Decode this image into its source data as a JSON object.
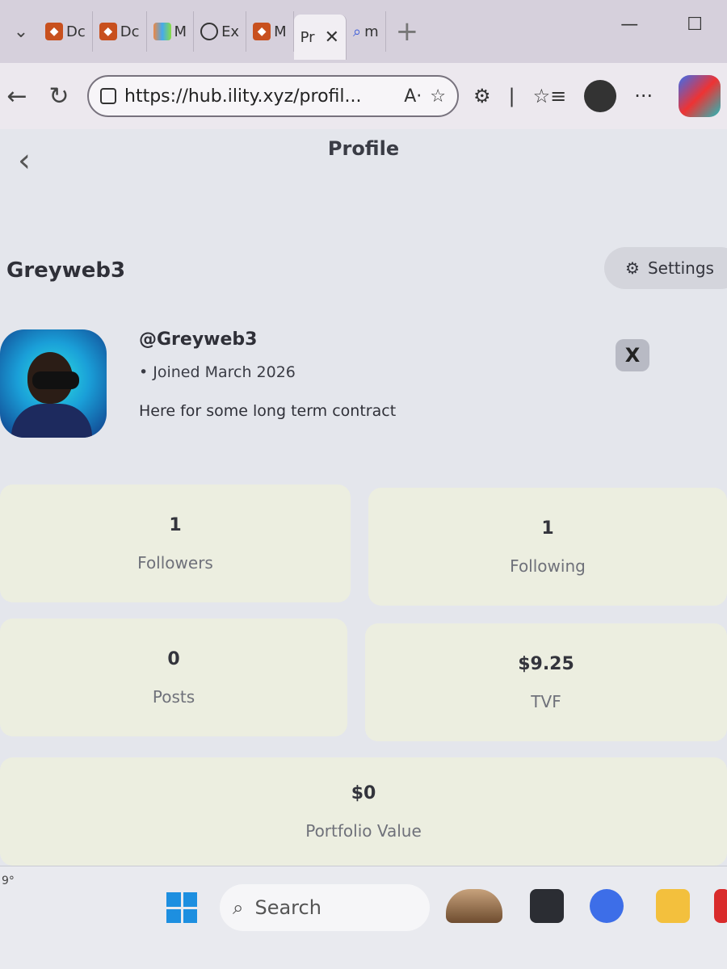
{
  "browser": {
    "tab_dropdown_icon": "chevron-down-icon",
    "tabs": [
      {
        "label": "Dc",
        "icon": "metamask-fox-icon"
      },
      {
        "label": "Dc",
        "icon": "metamask-fox-icon"
      },
      {
        "label": "M",
        "icon": "rainbow-icon"
      },
      {
        "label": "Ex",
        "icon": "extension-gear-icon"
      },
      {
        "label": "M",
        "icon": "metamask-fox-icon"
      },
      {
        "label": "Pr",
        "icon": "close-icon",
        "active": true
      },
      {
        "label": "m",
        "icon": "search-icon"
      }
    ],
    "close_glyph": "✕",
    "new_tab_glyph": "+",
    "url": "https://hub.ility.xyz/profil...",
    "read_aloud_glyph": "A·",
    "favorite_glyph": "☆",
    "favorites_glyph": "☆≡",
    "extensions_glyph": "⚙",
    "more_glyph": "···"
  },
  "page": {
    "back_glyph": "‹",
    "title": "Profile",
    "username": "Greyweb3",
    "settings_label": "Settings",
    "settings_icon": "gear-icon",
    "handle": "@Greyweb3",
    "joined": "• Joined March 2026",
    "bio": "Here for some long term contract",
    "x_glyph": "X",
    "stats": [
      {
        "value": "1",
        "label": "Followers"
      },
      {
        "value": "1",
        "label": "Following"
      },
      {
        "value": "0",
        "label": "Posts"
      },
      {
        "value": "$9.25",
        "label": "TVF"
      },
      {
        "value": "$0",
        "label": "Portfolio Value"
      }
    ]
  },
  "taskbar": {
    "temp": "9°",
    "search_label": "Search",
    "search_icon": "search-icon"
  }
}
